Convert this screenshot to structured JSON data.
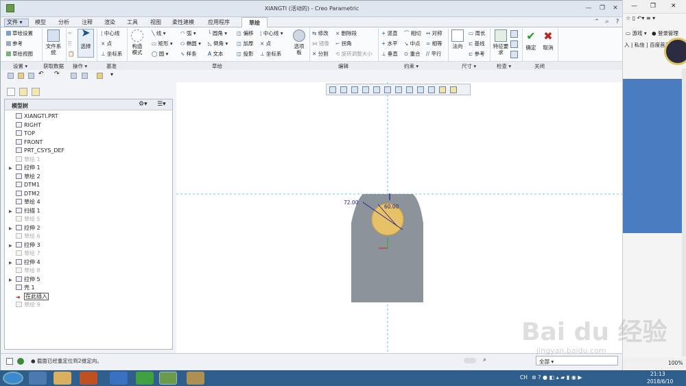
{
  "window": {
    "title": "XIANGTI (活动的) - Creo Parametric"
  },
  "ribbon_tabs": [
    "文件",
    "模型",
    "分析",
    "注释",
    "渲染",
    "工具",
    "视图",
    "柔性建模",
    "应用程序",
    "草绘"
  ],
  "ribbon": {
    "setup": [
      "草绘设置",
      "参考",
      "草绘视图"
    ],
    "get_data": {
      "file_system": "文件系统"
    },
    "operations": {
      "select": "选择"
    },
    "datum": [
      "中心线",
      "点",
      "坐标系"
    ],
    "construction": "构造模式",
    "sketch_col1": [
      "线",
      "矩形",
      "圆"
    ],
    "sketch_col2": [
      "弧",
      "椭圆",
      "样条"
    ],
    "sketch_col3": [
      "圆角",
      "倒角",
      "文本"
    ],
    "sketch_col4": [
      "偏移",
      "加厚",
      "投影"
    ],
    "sketch_col5": [
      "中心线",
      "点",
      "坐标系"
    ],
    "palette": "选项板",
    "editing_col1": [
      "修改",
      "镜像",
      "分割"
    ],
    "editing_col2": [
      "删除段",
      "拐角",
      "旋转调整大小"
    ],
    "constrain_col1": [
      "竖直",
      "水平",
      "垂直"
    ],
    "constrain_col2": [
      "相切",
      "中点",
      "重合"
    ],
    "constrain_col3": [
      "对称",
      "相等",
      "平行"
    ],
    "dimension": {
      "normal": "法向",
      "col": [
        "周长",
        "基线",
        "参考"
      ]
    },
    "inspect": {
      "feature_req": "特征要求"
    },
    "close": {
      "ok": "确定",
      "cancel": "取消"
    }
  },
  "group_labels": [
    "设置",
    "获取数据",
    "操作",
    "基准",
    "草绘",
    "编辑",
    "约束",
    "尺寸",
    "检查",
    "关闭"
  ],
  "model_tree": {
    "header": "模型树",
    "items": [
      {
        "label": "XIANGTI.PRT",
        "dim": false,
        "expand": false
      },
      {
        "label": "RIGHT",
        "dim": false,
        "expand": false
      },
      {
        "label": "TOP",
        "dim": false,
        "expand": false
      },
      {
        "label": "FRONT",
        "dim": false,
        "expand": false
      },
      {
        "label": "PRT_CSYS_DEF",
        "dim": false,
        "expand": false
      },
      {
        "label": "草绘 1",
        "dim": true,
        "expand": false
      },
      {
        "label": "拉伸 1",
        "dim": false,
        "expand": true
      },
      {
        "label": "草绘 2",
        "dim": false,
        "expand": false
      },
      {
        "label": "DTM1",
        "dim": false,
        "expand": false
      },
      {
        "label": "DTM2",
        "dim": false,
        "expand": false
      },
      {
        "label": "草绘 4",
        "dim": false,
        "expand": false
      },
      {
        "label": "扫描 1",
        "dim": false,
        "expand": true
      },
      {
        "label": "草绘 5",
        "dim": true,
        "expand": false
      },
      {
        "label": "拉伸 2",
        "dim": false,
        "expand": true
      },
      {
        "label": "草绘 6",
        "dim": true,
        "expand": false
      },
      {
        "label": "拉伸 3",
        "dim": false,
        "expand": true
      },
      {
        "label": "草绘 7",
        "dim": true,
        "expand": false
      },
      {
        "label": "拉伸 4",
        "dim": false,
        "expand": true
      },
      {
        "label": "草绘 8",
        "dim": true,
        "expand": false
      },
      {
        "label": "拉伸 5",
        "dim": false,
        "expand": true
      },
      {
        "label": "壳 1",
        "dim": false,
        "expand": false
      },
      {
        "label": "在此插入",
        "dim": false,
        "expand": false
      },
      {
        "label": "草绘 9",
        "dim": true,
        "expand": false
      }
    ]
  },
  "canvas": {
    "dim1": "72.00",
    "dim2": "60.00"
  },
  "status": {
    "message": "截面已经重定位到2维定向。",
    "filter": "全部"
  },
  "right_panel": {
    "games": "游戏",
    "login": "登录管理",
    "links": "入 | 私信 | 百度首页",
    "zoom": "100%"
  },
  "taskbar": {
    "time": "21:13",
    "date": "2018/6/10",
    "lang": "CH"
  },
  "watermark": {
    "brand": "Bai du 经验",
    "url": "jingyan.baidu.com"
  },
  "colors": {
    "part": "#8d939b",
    "circle": "#e6c168",
    "dim": "#1b1b8a",
    "datum": "#38b6d6",
    "taskbar": "#2f5e8c"
  }
}
